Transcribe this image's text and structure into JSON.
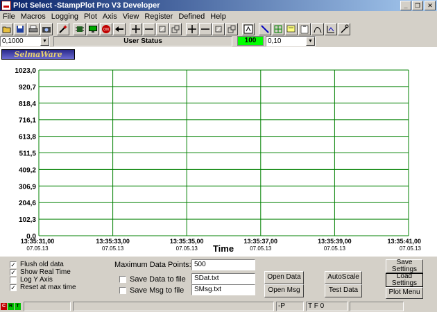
{
  "window": {
    "title": "Plot Select -StampPlot Pro V3 Developer"
  },
  "menu": [
    "File",
    "Macros",
    "Logging",
    "Plot",
    "Axis",
    "View",
    "Register",
    "Defined",
    "Help"
  ],
  "toolbar": {
    "icons": [
      "open-icon",
      "save-icon",
      "print-icon",
      "camera-icon",
      "wand-icon",
      "chip-icon",
      "monitor-icon",
      "record-icon",
      "back-arrow-icon",
      "plus-x-icon",
      "minus-x-icon",
      "box-icon",
      "boxes-icon",
      "plus-y-icon",
      "minus-y-icon",
      "box-y-icon",
      "boxes-y-icon",
      "zoom-icon",
      "pen-icon",
      "grid-icon",
      "note-icon",
      "clipboard-icon",
      "curve-icon",
      "axis-icon",
      "magic-icon"
    ]
  },
  "statusrow": {
    "interval_value": "0,1000",
    "user_status": "User Status",
    "indicator": "100",
    "secondary_value": "0,10"
  },
  "logo_text": "SelmaWare",
  "chart_data": {
    "type": "line",
    "xlabel": "Time",
    "ylabel": "",
    "ylim": [
      0,
      1023.0
    ],
    "yticks": [
      "1023,0",
      "920,7",
      "818,4",
      "716,1",
      "613,8",
      "511,5",
      "409,2",
      "306,9",
      "204,6",
      "102,3",
      "0,0"
    ],
    "xticks": [
      {
        "time": "13:35:31,00",
        "date": "07.05.13"
      },
      {
        "time": "13:35:33,00",
        "date": "07.05.13"
      },
      {
        "time": "13:35:35,00",
        "date": "07.05.13"
      },
      {
        "time": "13:35:37,00",
        "date": "07.05.13"
      },
      {
        "time": "13:35:39,00",
        "date": "07.05.13"
      },
      {
        "time": "13:35:41,00",
        "date": "07.05.13"
      }
    ],
    "grid": true,
    "series": [],
    "grid_color": "#008000"
  },
  "panel": {
    "checkboxes": [
      {
        "label": "Flush old data",
        "checked": true
      },
      {
        "label": "Show Real Time",
        "checked": true
      },
      {
        "label": "Log Y Axis",
        "checked": false
      },
      {
        "label": "Reset at max time",
        "checked": true
      }
    ],
    "max_points_label": "Maximum Data Points:",
    "max_points_value": "500",
    "save_data": {
      "label": "Save Data to file",
      "checked": false,
      "file": "SDat.txt"
    },
    "save_msg": {
      "label": "Save Msg to file",
      "checked": false,
      "file": "SMsg.txt"
    },
    "buttons": {
      "open_data": "Open Data",
      "open_msg": "Open Msg",
      "autoscale": "AutoScale",
      "test_data": "Test Data",
      "save_settings": "Save Settings",
      "load_settings": "Load Settings",
      "plot_menu": "Plot Menu"
    }
  },
  "statusbar": {
    "leds": [
      "C",
      "R",
      "T"
    ],
    "mode": "-P",
    "flags": "T F 0"
  },
  "colors": {
    "titlebar": "#0a246a",
    "indicator": "#00ff00",
    "grid": "#008000"
  }
}
